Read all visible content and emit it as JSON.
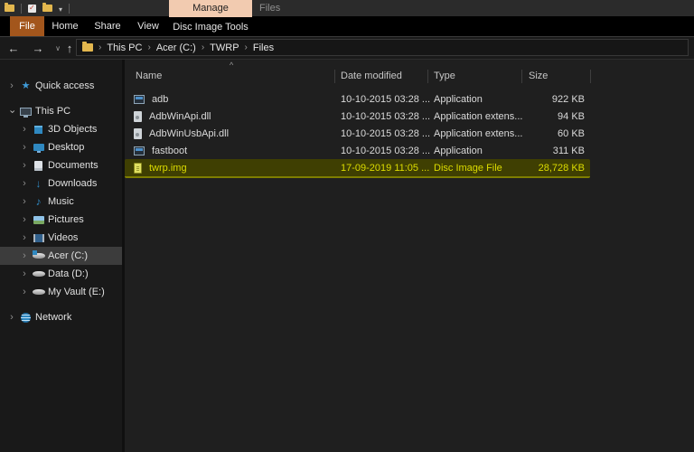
{
  "titlebar": {
    "contextual_group": "Manage",
    "window_title": "Files"
  },
  "ribbon": {
    "file_tab": "File",
    "tabs": [
      "Home",
      "Share",
      "View",
      "Disc Image Tools"
    ]
  },
  "icons": {
    "back": "←",
    "forward": "→",
    "recents_dropdown": "∨",
    "up": "↑"
  },
  "address_bar": {
    "crumbs": [
      "This PC",
      "Acer (C:)",
      "TWRP",
      "Files"
    ]
  },
  "sidebar": {
    "quick_access": "Quick access",
    "this_pc": "This PC",
    "children": [
      "3D Objects",
      "Desktop",
      "Documents",
      "Downloads",
      "Music",
      "Pictures",
      "Videos",
      "Acer (C:)",
      "Data (D:)",
      "My Vault (E:)"
    ],
    "network": "Network",
    "selected_item": "Acer (C:)"
  },
  "file_list": {
    "columns": [
      "Name",
      "Date modified",
      "Type",
      "Size"
    ],
    "sort": {
      "column": "Name",
      "direction": "ascending"
    },
    "rows": [
      {
        "name": "adb",
        "date_modified": "10-10-2015 03:28 ...",
        "type": "Application",
        "size": "922 KB"
      },
      {
        "name": "AdbWinApi.dll",
        "date_modified": "10-10-2015 03:28 ...",
        "type": "Application extens...",
        "size": "94 KB"
      },
      {
        "name": "AdbWinUsbApi.dll",
        "date_modified": "10-10-2015 03:28 ...",
        "type": "Application extens...",
        "size": "60 KB"
      },
      {
        "name": "fastboot",
        "date_modified": "10-10-2015 03:28 ...",
        "type": "Application",
        "size": "311 KB"
      },
      {
        "name": "twrp.img",
        "date_modified": "17-09-2019 11:05 ...",
        "type": "Disc Image File",
        "size": "28,728 KB"
      }
    ],
    "highlighted_row": "twrp.img"
  },
  "colors": {
    "manage_tab_bg": "#f2cbb0",
    "file_tab_bg": "#a3561c",
    "highlight_bg": "#3f3f02",
    "highlight_text": "#dcdc00",
    "sidebar_selection_bg": "#3c3c3c"
  }
}
